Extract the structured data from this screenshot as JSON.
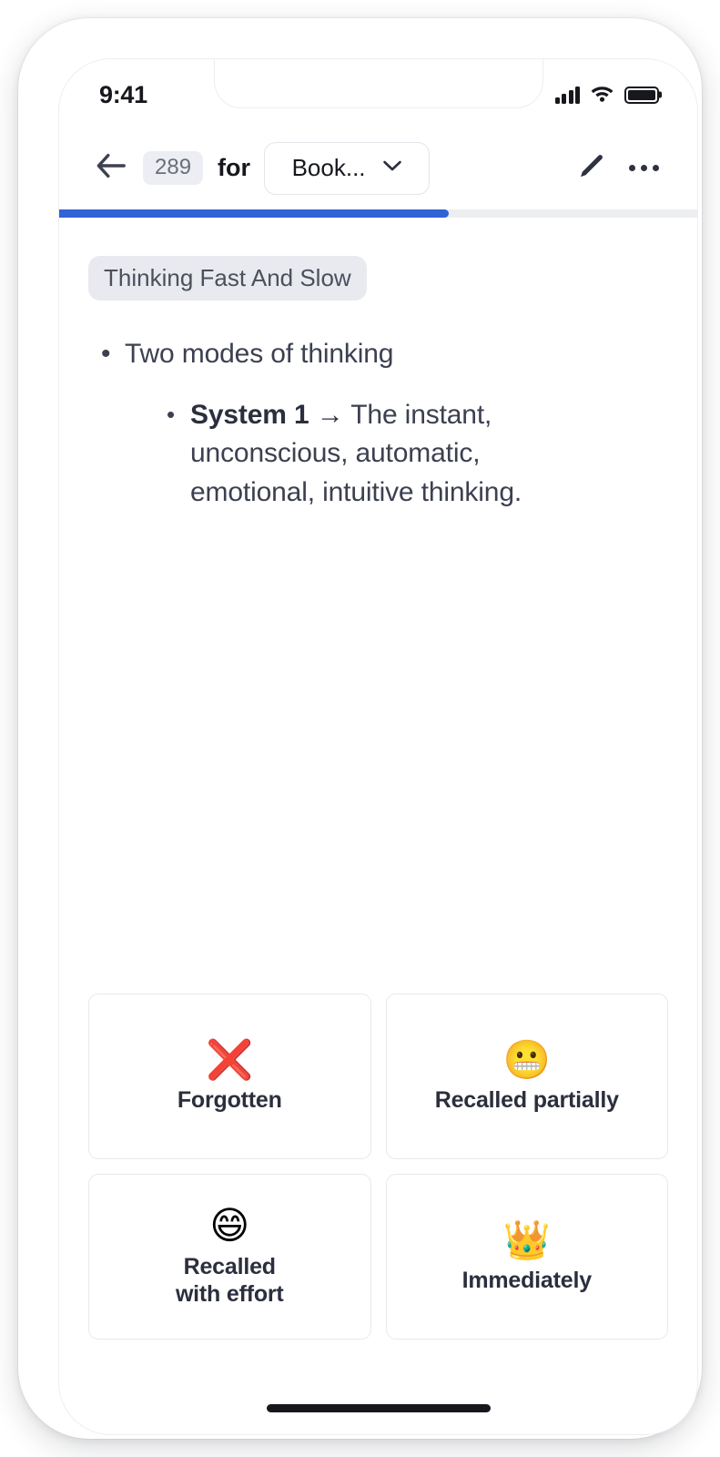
{
  "status_bar": {
    "time": "9:41",
    "signal_icon": "cellular-signal-icon",
    "wifi_icon": "wifi-icon",
    "battery_icon": "battery-full-icon",
    "battery_level_percent": 100
  },
  "header": {
    "back_icon": "arrow-left-icon",
    "count_badge": "289",
    "for_label": "for",
    "deck_name": "Book...",
    "deck_chevron_icon": "chevron-down-icon",
    "edit_icon": "pencil-icon",
    "more_icon": "ellipsis-horizontal-icon"
  },
  "progress": {
    "percent": 61,
    "fill_color": "#3063d5",
    "track_color": "#eceef2"
  },
  "card": {
    "deck_tag": "Thinking Fast And Slow",
    "bullets": [
      {
        "level": 1,
        "marker": "•",
        "text": "Two modes of thinking"
      },
      {
        "level": 2,
        "marker": "•",
        "bold_text": "System 1",
        "arrow": "→",
        "text": " The instant, unconscious, automatic, emotional, intuitive thinking."
      }
    ]
  },
  "answers": [
    {
      "emoji": "❌",
      "emoji_name": "cross-mark-icon",
      "label": "Forgotten"
    },
    {
      "emoji": "😬",
      "emoji_name": "grimacing-face-icon",
      "label": "Recalled partially"
    },
    {
      "emoji": "😄",
      "emoji_name": "grinning-face-icon",
      "label": "Recalled\nwith effort"
    },
    {
      "emoji": "👑",
      "emoji_name": "crown-icon",
      "label": "Immediately"
    }
  ],
  "home_indicator": "home-indicator-bar"
}
